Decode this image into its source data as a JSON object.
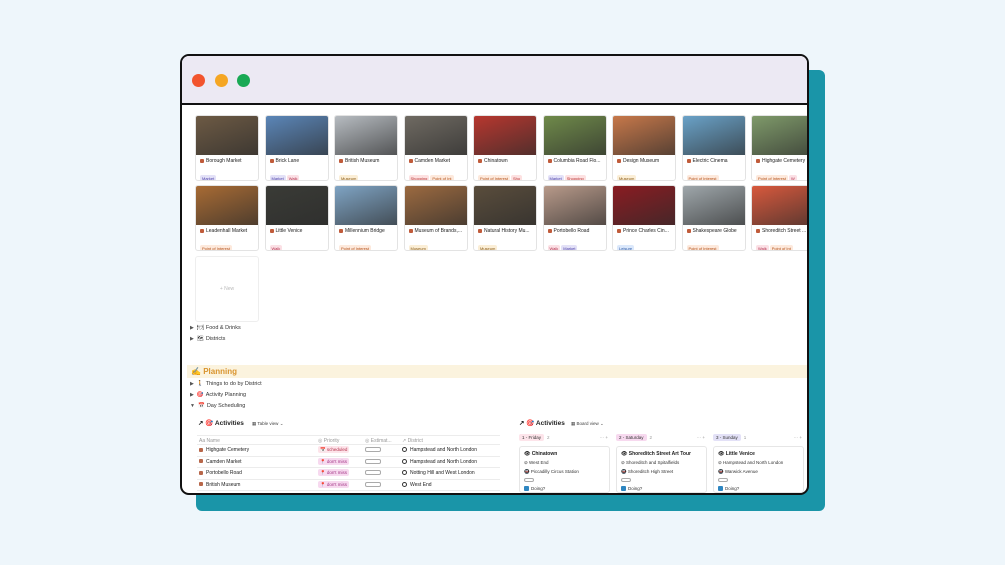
{
  "window": {
    "traffic_lights": [
      "close",
      "minimize",
      "maximize"
    ],
    "colors": {
      "frame_accent": "#1a95a8",
      "titlebar": "#ece9f3"
    }
  },
  "gallery": {
    "cards": [
      {
        "title": "Borough Market",
        "tags": [
          {
            "t": "Market",
            "c": "t-market"
          }
        ],
        "color": "#6d5a44"
      },
      {
        "title": "Brick Lane",
        "tags": [
          {
            "t": "Market",
            "c": "t-market"
          },
          {
            "t": "Walk",
            "c": "t-walk"
          }
        ],
        "color": "#5b86b8"
      },
      {
        "title": "British Museum",
        "tags": [
          {
            "t": "Museum",
            "c": "t-museum"
          }
        ],
        "color": "#b7bcc1"
      },
      {
        "title": "Camden Market",
        "tags": [
          {
            "t": "Shopping",
            "c": "t-shopping"
          },
          {
            "t": "Point of Int",
            "c": "t-poi"
          }
        ],
        "color": "#6f6a62"
      },
      {
        "title": "Chinatown",
        "tags": [
          {
            "t": "Point of Interest",
            "c": "t-poi"
          },
          {
            "t": "Sho",
            "c": "t-shopping"
          }
        ],
        "color": "#b7372f"
      },
      {
        "title": "Columbia Road Flo...",
        "tags": [
          {
            "t": "Market",
            "c": "t-market"
          },
          {
            "t": "Shopping",
            "c": "t-shopping"
          }
        ],
        "color": "#6f8a4a"
      },
      {
        "title": "Design Museum",
        "tags": [
          {
            "t": "Museum",
            "c": "t-museum"
          }
        ],
        "color": "#c7784a"
      },
      {
        "title": "Electric Cinema",
        "tags": [
          {
            "t": "Point of Interest",
            "c": "t-poi"
          }
        ],
        "color": "#6aa2c8"
      },
      {
        "title": "Highgate Cemetery",
        "tags": [
          {
            "t": "Point of Interest",
            "c": "t-poi"
          },
          {
            "t": "W",
            "c": "t-walk"
          }
        ],
        "color": "#7f9a6a"
      },
      {
        "title": "Leadenhall Market",
        "tags": [
          {
            "t": "Point of Interest",
            "c": "t-poi"
          }
        ],
        "color": "#a86b34"
      },
      {
        "title": "Little Venice",
        "tags": [
          {
            "t": "Walk",
            "c": "t-walk"
          }
        ],
        "color": "#3a3b36"
      },
      {
        "title": "Millennium Bridge",
        "tags": [
          {
            "t": "Point of Interest",
            "c": "t-poi"
          }
        ],
        "color": "#7fa4c4"
      },
      {
        "title": "Museum of Brands,...",
        "tags": [
          {
            "t": "Museum",
            "c": "t-museum"
          }
        ],
        "color": "#9c6a40"
      },
      {
        "title": "Natural History Mu...",
        "tags": [
          {
            "t": "Museum",
            "c": "t-museum"
          }
        ],
        "color": "#5a4d3c"
      },
      {
        "title": "Portobello Road",
        "tags": [
          {
            "t": "Walk",
            "c": "t-walk"
          },
          {
            "t": "Market",
            "c": "t-market"
          }
        ],
        "color": "#b89a8a"
      },
      {
        "title": "Prince Charles Cin...",
        "tags": [
          {
            "t": "Leisure",
            "c": "t-leisure"
          }
        ],
        "color": "#8a1c22"
      },
      {
        "title": "Shakespeare Globe",
        "tags": [
          {
            "t": "Point of Interest",
            "c": "t-poi"
          }
        ],
        "color": "#9fa7ab"
      },
      {
        "title": "Shoreditch Street ...",
        "tags": [
          {
            "t": "Walk",
            "c": "t-walk"
          },
          {
            "t": "Point of Int",
            "c": "t-poi"
          }
        ],
        "color": "#d8593d"
      }
    ],
    "new_label": "+ New"
  },
  "toggles": {
    "food": "Food & Drinks",
    "districts": "Districts",
    "things": "Things to do by District",
    "activity": "Activity Planning",
    "day": "Day Scheduling"
  },
  "planning_heading": "Planning",
  "table_db": {
    "title": "Activities",
    "view": "Table view",
    "headers": [
      "Name",
      "Priority",
      "Estimat...",
      "District"
    ],
    "rows": [
      {
        "name": "Highgate Cemetery",
        "priority": "scheduled",
        "pclass": "p-sched",
        "district": "Hampstead and North London"
      },
      {
        "name": "Camden Market",
        "priority": "don't miss",
        "pclass": "p-dont",
        "district": "Hampstead and North London"
      },
      {
        "name": "Portobello Road",
        "priority": "don't miss",
        "pclass": "p-dont",
        "district": "Notting Hill and West London"
      },
      {
        "name": "British Museum",
        "priority": "don't miss",
        "pclass": "p-dont",
        "district": "West End"
      }
    ]
  },
  "board_db": {
    "title": "Activities",
    "view": "Board view",
    "columns": [
      {
        "label": "1 - Friday",
        "count": "2",
        "bg": "#fde4ea",
        "card": {
          "title": "Chinatown",
          "district": "West End",
          "station": "Piccadilly Circus Station",
          "done": "Doing?"
        }
      },
      {
        "label": "2 - Saturday",
        "count": "2",
        "bg": "#f7d9ef",
        "card": {
          "title": "Shoreditch Street Art Tour",
          "district": "Shoreditch and Spitalfields",
          "station": "Shoreditch High Street",
          "done": "Doing?"
        }
      },
      {
        "label": "3 - Sunday",
        "count": "1",
        "bg": "#e3e1f7",
        "card": {
          "title": "Little Venice",
          "district": "Hampstead and North London",
          "station": "Warwick Avenue",
          "done": "Doing?"
        }
      }
    ]
  }
}
